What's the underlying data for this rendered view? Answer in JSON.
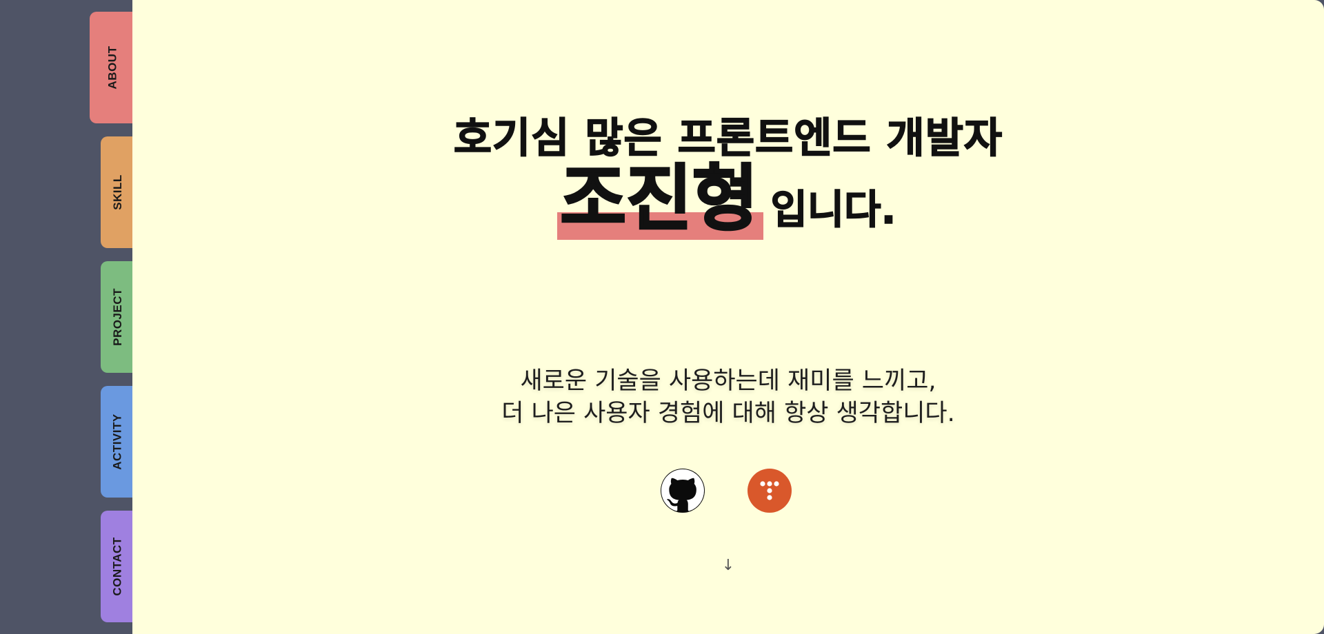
{
  "sidebar": {
    "tabs": [
      {
        "label": "ABOUT",
        "color": "#e57f7c"
      },
      {
        "label": "SKILL",
        "color": "#e0a163"
      },
      {
        "label": "PROJECT",
        "color": "#7dbc80"
      },
      {
        "label": "ACTIVITY",
        "color": "#6a99e0"
      },
      {
        "label": "CONTACT",
        "color": "#9f80e0"
      }
    ]
  },
  "hero": {
    "headline": "호기심 많은 프론트엔드 개발자",
    "name": "조진형",
    "name_suffix": "입니다.",
    "description_line1": "새로운 기술을 사용하는데 재미를 느끼고,",
    "description_line2": "더 나은 사용자 경험에 대해 항상 생각합니다."
  },
  "links": {
    "github_icon": "github-icon",
    "tistory_icon": "tistory-icon"
  },
  "scroll_indicator": "↓",
  "colors": {
    "background_dark": "#4f5466",
    "panel": "#ffffdc",
    "highlight": "#e57f7c"
  }
}
